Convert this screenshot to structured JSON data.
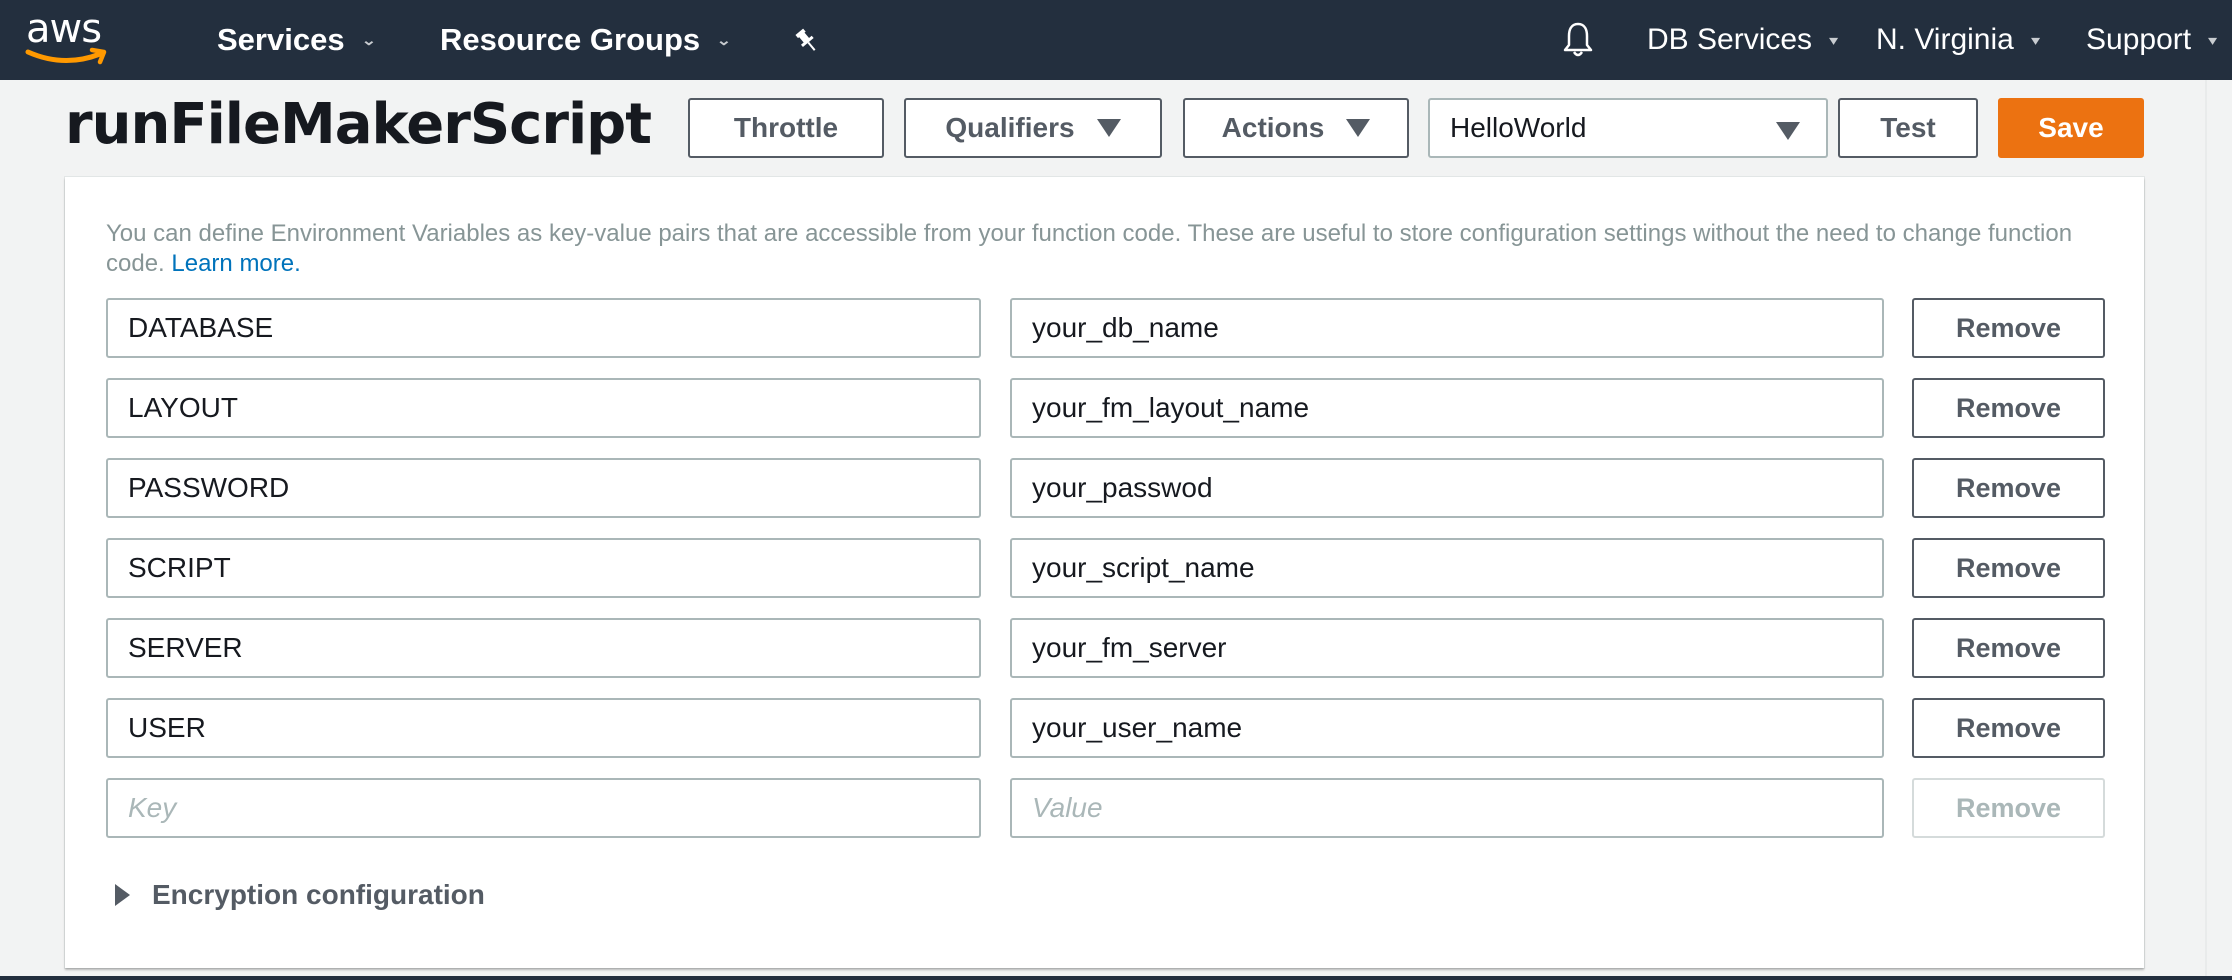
{
  "nav": {
    "logo_text": "aws",
    "services": "Services",
    "resource_groups": "Resource Groups",
    "pin_icon": "pushpin-icon",
    "bell_icon": "bell-icon",
    "account": "DB Services",
    "region": "N. Virginia",
    "support": "Support"
  },
  "header": {
    "title": "runFileMakerScript",
    "throttle": "Throttle",
    "qualifiers": "Qualifiers",
    "actions": "Actions",
    "test_event_selected": "HelloWorld",
    "test": "Test",
    "save": "Save"
  },
  "colors": {
    "nav_bg": "#232f3e",
    "primary": "#ec7211",
    "link": "#0073bb",
    "logo_smile": "#ff9900"
  },
  "env": {
    "description": "You can define Environment Variables as key-value pairs that are accessible from your function code. These are useful to store configuration settings without the need to change function code.",
    "learn_more": "Learn more.",
    "remove_label": "Remove",
    "rows": [
      {
        "key": "DATABASE",
        "value": "your_db_name"
      },
      {
        "key": "LAYOUT",
        "value": "your_fm_layout_name"
      },
      {
        "key": "PASSWORD",
        "value": "your_passwod"
      },
      {
        "key": "SCRIPT",
        "value": "your_script_name"
      },
      {
        "key": "SERVER",
        "value": "your_fm_server"
      },
      {
        "key": "USER",
        "value": "your_user_name"
      }
    ],
    "new_row": {
      "key_placeholder": "Key",
      "value_placeholder": "Value",
      "remove": "Remove"
    },
    "encryption": "Encryption configuration"
  }
}
